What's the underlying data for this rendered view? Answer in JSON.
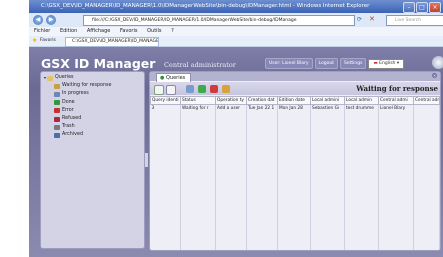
{
  "browser": {
    "title": "C:\\GSX_DEV\\ID_MANAGER\\ID_MANAGER\\1.0\\IDManagerWebSite\\bin-debug\\IDManager.html - Windows Internet Explorer",
    "url": "file:///C:/GSX_DEV/ID_MANAGER/ID_MANAGER/1.0/IDManagerWebSite/bin-debug/IDManage",
    "search_placeholder": "Live Search",
    "menu": [
      "Fichier",
      "Edition",
      "Affichage",
      "Favoris",
      "Outils",
      "?"
    ],
    "favorites_label": "Favoris",
    "tab_title": "C:\\GSX_DEV\\ID_MANAGER\\ID_MANAGER\\1.0\\IDMana..."
  },
  "app": {
    "logo": "GSX ID Manager",
    "subtitle": "Central administrator",
    "user": "User: Lionel Blary",
    "logout": "Logout",
    "settings": "Settings",
    "language": "English"
  },
  "sidebar": {
    "root": "Queries",
    "items": [
      {
        "label": "Waiting for response",
        "icon": "hourglass-icon",
        "color": "#c9a13b"
      },
      {
        "label": "In progress",
        "icon": "gears-icon",
        "color": "#6b86b8"
      },
      {
        "label": "Done",
        "icon": "check-icon",
        "color": "#2e9a3a"
      },
      {
        "label": "Error",
        "icon": "error-icon",
        "color": "#c53030"
      },
      {
        "label": "Refused",
        "icon": "refused-icon",
        "color": "#b0263a"
      },
      {
        "label": "Trash",
        "icon": "trash-icon",
        "color": "#7a7a7a"
      },
      {
        "label": "Archived",
        "icon": "archive-icon",
        "color": "#4a6fa8"
      }
    ]
  },
  "main": {
    "tab_label": "Queries",
    "heading": "Waiting for response",
    "columns": [
      "Query identi",
      "Status",
      "Operation ty",
      "Creation dat",
      "Edition date",
      "Local admini",
      "Local admin",
      "Central admi",
      "Central admi"
    ],
    "rows": [
      [
        "3",
        "Waiting for r",
        "Add a user",
        "Tue Jan 22 1",
        "Mon Jan 28",
        "Sebastien Gi",
        "test drumme",
        "Lionel Blary",
        ""
      ]
    ]
  }
}
